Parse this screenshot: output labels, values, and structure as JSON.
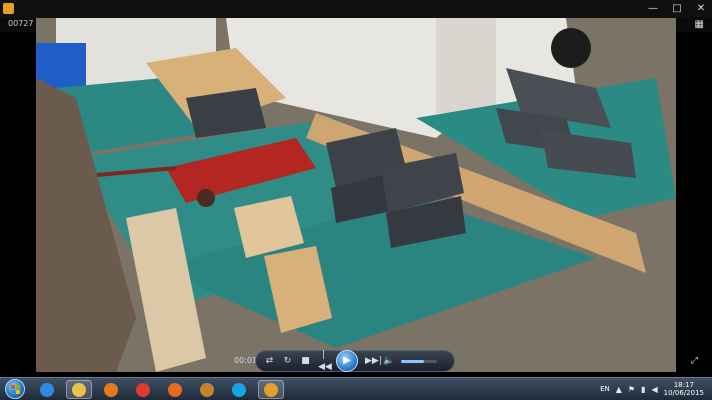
{
  "window": {
    "frame_label": "00727",
    "controls": {
      "minimize": "—",
      "maximize": "□",
      "close": "✕"
    },
    "top_right_icon": "grid-icon"
  },
  "player": {
    "time": "00:01",
    "buttons": [
      {
        "name": "shuffle-icon",
        "glyph": "⇄"
      },
      {
        "name": "repeat-icon",
        "glyph": "↻"
      },
      {
        "name": "stop-icon",
        "glyph": "■"
      },
      {
        "name": "previous-icon",
        "glyph": "|◀◀"
      },
      {
        "name": "next-icon",
        "glyph": "▶▶|"
      },
      {
        "name": "volume-icon",
        "glyph": "🔈"
      }
    ],
    "play_glyph": "▶",
    "volume_level": 0.65,
    "fullscreen_glyph": "⤢"
  },
  "taskbar": {
    "apps": [
      {
        "name": "internet-explorer-icon",
        "color": "#2d8ae0"
      },
      {
        "name": "file-explorer-icon",
        "color": "#e8c24a"
      },
      {
        "name": "media-player-icon",
        "color": "#e4781f"
      },
      {
        "name": "chrome-icon",
        "color": "#dd3c2e"
      },
      {
        "name": "firefox-icon",
        "color": "#e66b1d"
      },
      {
        "name": "app-icon",
        "color": "#c7822e"
      },
      {
        "name": "skype-icon",
        "color": "#1aa4e6"
      },
      {
        "name": "video-player-icon",
        "color": "#e0a22b"
      }
    ],
    "language": "EN",
    "tray": [
      "chevron-up-icon",
      "flag-icon",
      "network-icon",
      "volume-icon"
    ],
    "time": "18:17",
    "date": "10/06/2015"
  },
  "colors": {
    "carpet": "#2f8c86",
    "brick": "#3d4248",
    "jack": "#b42622",
    "wood": "#d8b07a"
  }
}
